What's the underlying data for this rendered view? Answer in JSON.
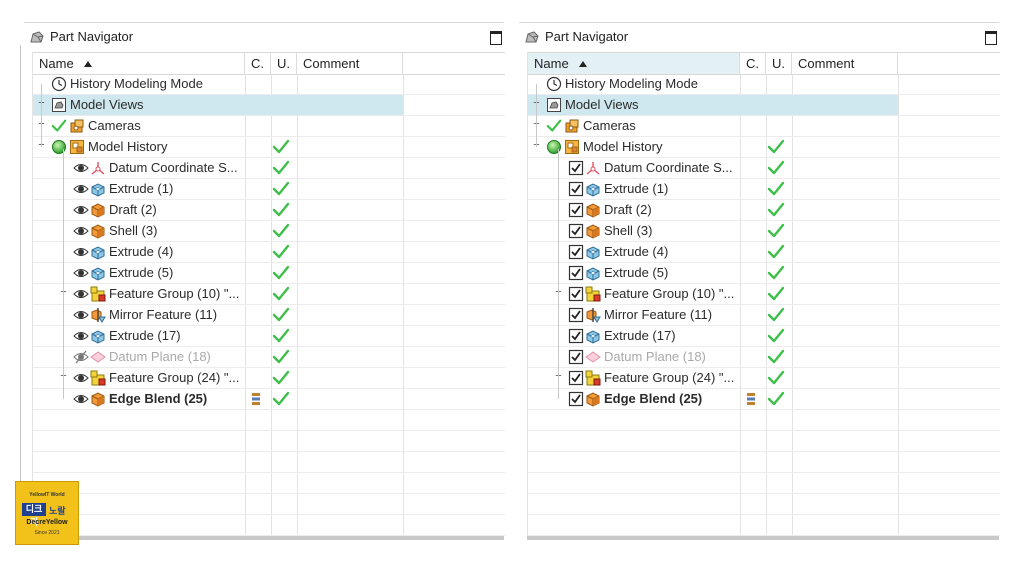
{
  "panel_title": "Part Navigator",
  "columns": {
    "name": "Name",
    "c": "C.",
    "u": "U.",
    "comment": "Comment"
  },
  "rows": [
    {
      "label": "History Modeling Mode"
    },
    {
      "label": "Model Views"
    },
    {
      "label": "Cameras"
    },
    {
      "label": "Model History"
    },
    {
      "label": "Datum Coordinate S..."
    },
    {
      "label": "Extrude (1)"
    },
    {
      "label": "Draft (2)"
    },
    {
      "label": "Shell (3)"
    },
    {
      "label": "Extrude (4)"
    },
    {
      "label": "Extrude (5)"
    },
    {
      "label": "Feature Group (10) \"..."
    },
    {
      "label": "Mirror Feature (11)"
    },
    {
      "label": "Extrude (17)"
    },
    {
      "label": "Datum Plane (18)"
    },
    {
      "label": "Feature Group (24) \"..."
    },
    {
      "label": "Edge Blend (25)"
    }
  ],
  "watermark": {
    "top": "YellowIT World",
    "box": "디크리",
    "side": "노랄",
    "middle": "DecreYellow",
    "bottom": "Since 2021"
  },
  "colors": {
    "selection": "#cfe7ee",
    "check": "#3fbf4a"
  }
}
